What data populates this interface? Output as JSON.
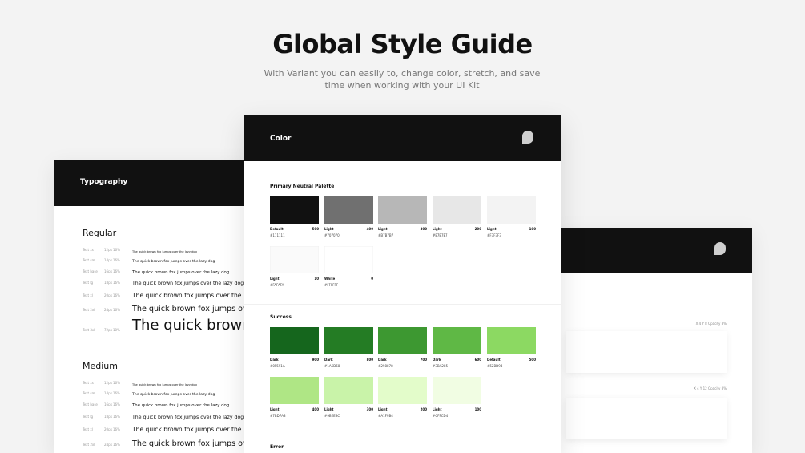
{
  "hero": {
    "title": "Global Style Guide",
    "subtitle": "With Variant you can easily to, change color, stretch, and save time when working with your UI Kit"
  },
  "typography": {
    "header": "Typography",
    "sample_text": "The quick brown fox jumps over the lazy dog",
    "sections": [
      {
        "title": "Regular",
        "rows": [
          {
            "c1": "Text xs",
            "c2": "12px",
            "c3": "16%"
          },
          {
            "c1": "Text sm",
            "c2": "14px",
            "c3": "16%"
          },
          {
            "c1": "Text base",
            "c2": "16px",
            "c3": "16%"
          },
          {
            "c1": "Text lg",
            "c2": "18px",
            "c3": "16%"
          },
          {
            "c1": "Text xl",
            "c2": "20px",
            "c3": "16%"
          },
          {
            "c1": "Text 2xl",
            "c2": "24px",
            "c3": "16%"
          },
          {
            "c1": "Text 3xl",
            "c2": "72px",
            "c3": "10%"
          }
        ]
      },
      {
        "title": "Medium",
        "rows": [
          {
            "c1": "Text xs",
            "c2": "12px",
            "c3": "16%"
          },
          {
            "c1": "Text sm",
            "c2": "14px",
            "c3": "16%"
          },
          {
            "c1": "Text base",
            "c2": "16px",
            "c3": "16%"
          },
          {
            "c1": "Text lg",
            "c2": "18px",
            "c3": "16%"
          },
          {
            "c1": "Text xl",
            "c2": "20px",
            "c3": "16%"
          },
          {
            "c1": "Text 2xl",
            "c2": "24px",
            "c3": "16%"
          }
        ]
      }
    ]
  },
  "color": {
    "header": "Color",
    "logo_icon": "p-logo-icon",
    "sections": [
      {
        "title": "Primary Neutral Palette",
        "swatches": [
          {
            "name": "Default",
            "weight": "500",
            "hex": "#111111",
            "color": "#111111"
          },
          {
            "name": "Light",
            "weight": "400",
            "hex": "#707070",
            "color": "#707070"
          },
          {
            "name": "Light",
            "weight": "300",
            "hex": "#B7B7B7",
            "color": "#B7B7B7"
          },
          {
            "name": "Light",
            "weight": "200",
            "hex": "#E7E7E7",
            "color": "#E7E7E7"
          },
          {
            "name": "Light",
            "weight": "100",
            "hex": "#F3F3F3",
            "color": "#F3F3F3"
          },
          {
            "name": "Light",
            "weight": "10",
            "hex": "#FAFAFA",
            "color": "#FAFAFA"
          },
          {
            "name": "White",
            "weight": "0",
            "hex": "#FFFFFF",
            "color": "#FFFFFF"
          }
        ]
      },
      {
        "title": "Success",
        "swatches": [
          {
            "name": "Dark",
            "weight": "900",
            "hex": "#0F591A",
            "color": "#15661D"
          },
          {
            "name": "Dark",
            "weight": "800",
            "hex": "#1A6D68",
            "color": "#247C24"
          },
          {
            "name": "Dark",
            "weight": "700",
            "hex": "#298878",
            "color": "#3D9831"
          },
          {
            "name": "Dark",
            "weight": "600",
            "hex": "#3BA285",
            "color": "#5FB845"
          },
          {
            "name": "Default",
            "weight": "500",
            "hex": "#52BD94",
            "color": "#8CD962"
          },
          {
            "name": "Light",
            "weight": "400",
            "hex": "#7BD7A8",
            "color": "#AFE685"
          },
          {
            "name": "Light",
            "weight": "300",
            "hex": "#9BEEBC",
            "color": "#C9F3A9"
          },
          {
            "name": "Light",
            "weight": "200",
            "hex": "#A1F9B4",
            "color": "#E3FCCA"
          },
          {
            "name": "Light",
            "weight": "100",
            "hex": "#CFFCD4",
            "color": "#F1FDE3"
          }
        ]
      },
      {
        "title": "Error",
        "swatches": []
      }
    ]
  },
  "right_card": {
    "logo_icon": "p-logo-icon",
    "labels": [
      "X 4 Y 8 Opacity 8%",
      "X 4 Y 12 Opacity 8%"
    ]
  }
}
